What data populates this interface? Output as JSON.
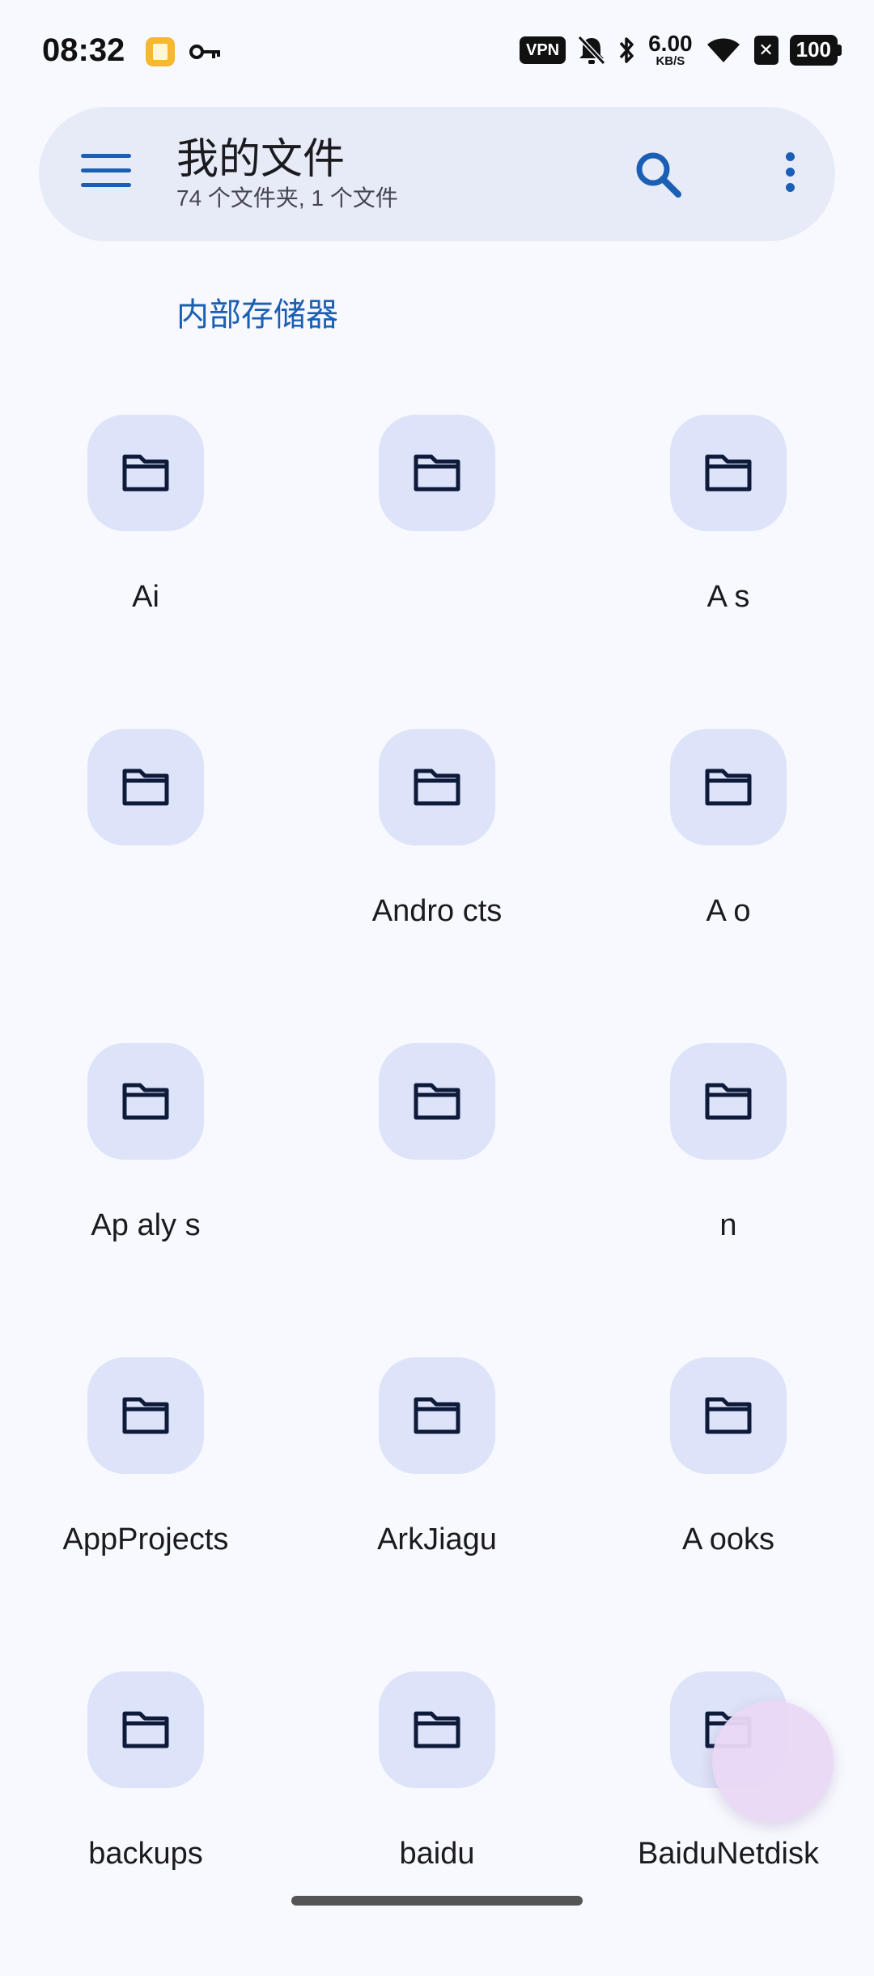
{
  "status_bar": {
    "time": "08:32",
    "vpn": "VPN",
    "speed_value": "6.00",
    "speed_unit": "KB/S",
    "battery": "100"
  },
  "app_bar": {
    "title": "我的文件",
    "subtitle": "74 个文件夹, 1 个文件"
  },
  "breadcrumb": "内部存储器",
  "folders": [
    {
      "name": "Ai"
    },
    {
      "name": ""
    },
    {
      "name": "A    s"
    },
    {
      "name": ""
    },
    {
      "name": "Andro    cts"
    },
    {
      "name": "A    o"
    },
    {
      "name": "Ap    aly    s"
    },
    {
      "name": ""
    },
    {
      "name": "    n"
    },
    {
      "name": "AppProjects"
    },
    {
      "name": "ArkJiagu"
    },
    {
      "name": "A    ooks"
    },
    {
      "name": "backups"
    },
    {
      "name": "baidu"
    },
    {
      "name": "BaiduNetdisk"
    }
  ],
  "colors": {
    "accent": "#1a5fb4",
    "app_bar_bg": "#e7ebf8",
    "folder_tile": "#dde3f8",
    "fab": "#ead9f6"
  }
}
